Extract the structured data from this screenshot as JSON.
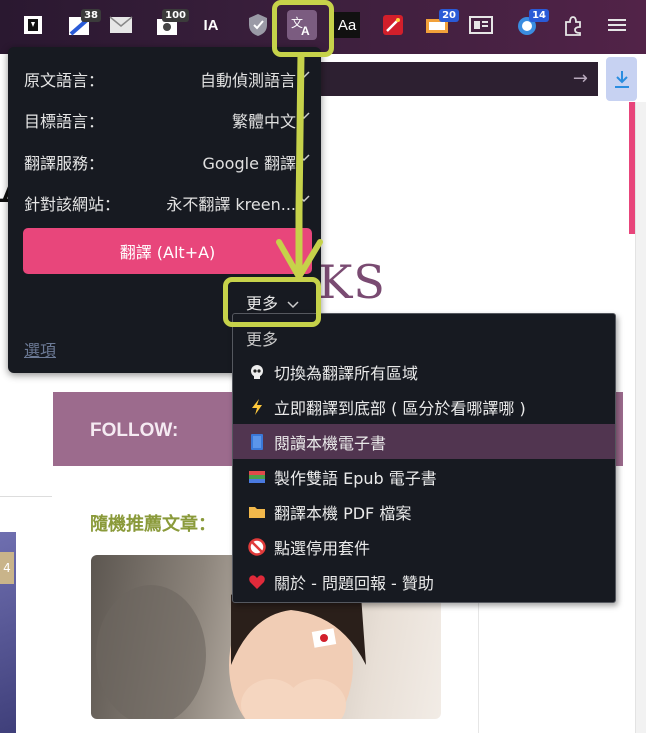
{
  "toolbar": {
    "icons": [
      {
        "name": "bookmark-extension-icon",
        "badge": ""
      },
      {
        "name": "notes-extension-icon",
        "badge": "38"
      },
      {
        "name": "mail-icon",
        "badge": ""
      },
      {
        "name": "screenshot-extension-icon",
        "badge": "100"
      },
      {
        "name": "ia-extension-icon",
        "label": "IA",
        "badge": ""
      },
      {
        "name": "shield-check-icon",
        "badge": ""
      },
      {
        "name": "translate-extension-icon",
        "badge": ""
      },
      {
        "name": "font-extension-icon",
        "label": "Aa",
        "badge": ""
      },
      {
        "name": "magic-wand-icon",
        "badge": ""
      },
      {
        "name": "monitor-extension-icon",
        "badge": "20"
      },
      {
        "name": "reader-view-icon",
        "badge": ""
      },
      {
        "name": "clock-extension-icon",
        "badge": "14"
      },
      {
        "name": "extensions-puzzle-icon",
        "badge": ""
      },
      {
        "name": "menu-hamburger-icon",
        "badge": ""
      }
    ],
    "badges": {
      "notes": "38",
      "screenshot": "100",
      "monitor": "20",
      "clock": "14"
    },
    "ia_label": "IA",
    "font_label": "Aa"
  },
  "popup": {
    "rows": [
      {
        "label": "原文語言：",
        "value": "自動偵測語言"
      },
      {
        "label": "目標語言：",
        "value": "繁體中文"
      },
      {
        "label": "翻譯服務：",
        "value": "Google 翻譯"
      },
      {
        "label": "針對該網站：",
        "value": "永不翻譯 kreen..."
      }
    ],
    "translate_button": "翻譯 (Alt+A)",
    "more_label": "更多",
    "options_link": "選項"
  },
  "menu": {
    "header": "更多",
    "items": [
      {
        "icon": "skull-icon",
        "label": "切換為翻譯所有區域"
      },
      {
        "icon": "lightning-icon",
        "label": "立即翻譯到底部 ( 區分於看哪譯哪 )"
      },
      {
        "icon": "book-icon",
        "label": "閱讀本機電子書",
        "selected": true
      },
      {
        "icon": "books-icon",
        "label": "製作雙語 Epub 電子書"
      },
      {
        "icon": "folder-icon",
        "label": "翻譯本機 PDF 檔案"
      },
      {
        "icon": "no-entry-icon",
        "label": "點選停用套件"
      },
      {
        "icon": "heart-icon",
        "label": "關於 - 問題回報 - 贊助"
      }
    ]
  },
  "page": {
    "big_letter": "A",
    "logo_partial": "KS",
    "follow": "FOLLOW:",
    "recommend": "隨機推薦文章：",
    "left_tag": "4"
  },
  "colors": {
    "accent_pink": "#e8467b",
    "highlight_yellow": "#c6d24a",
    "menu_selected": "#513550",
    "popup_bg": "#171a21"
  }
}
